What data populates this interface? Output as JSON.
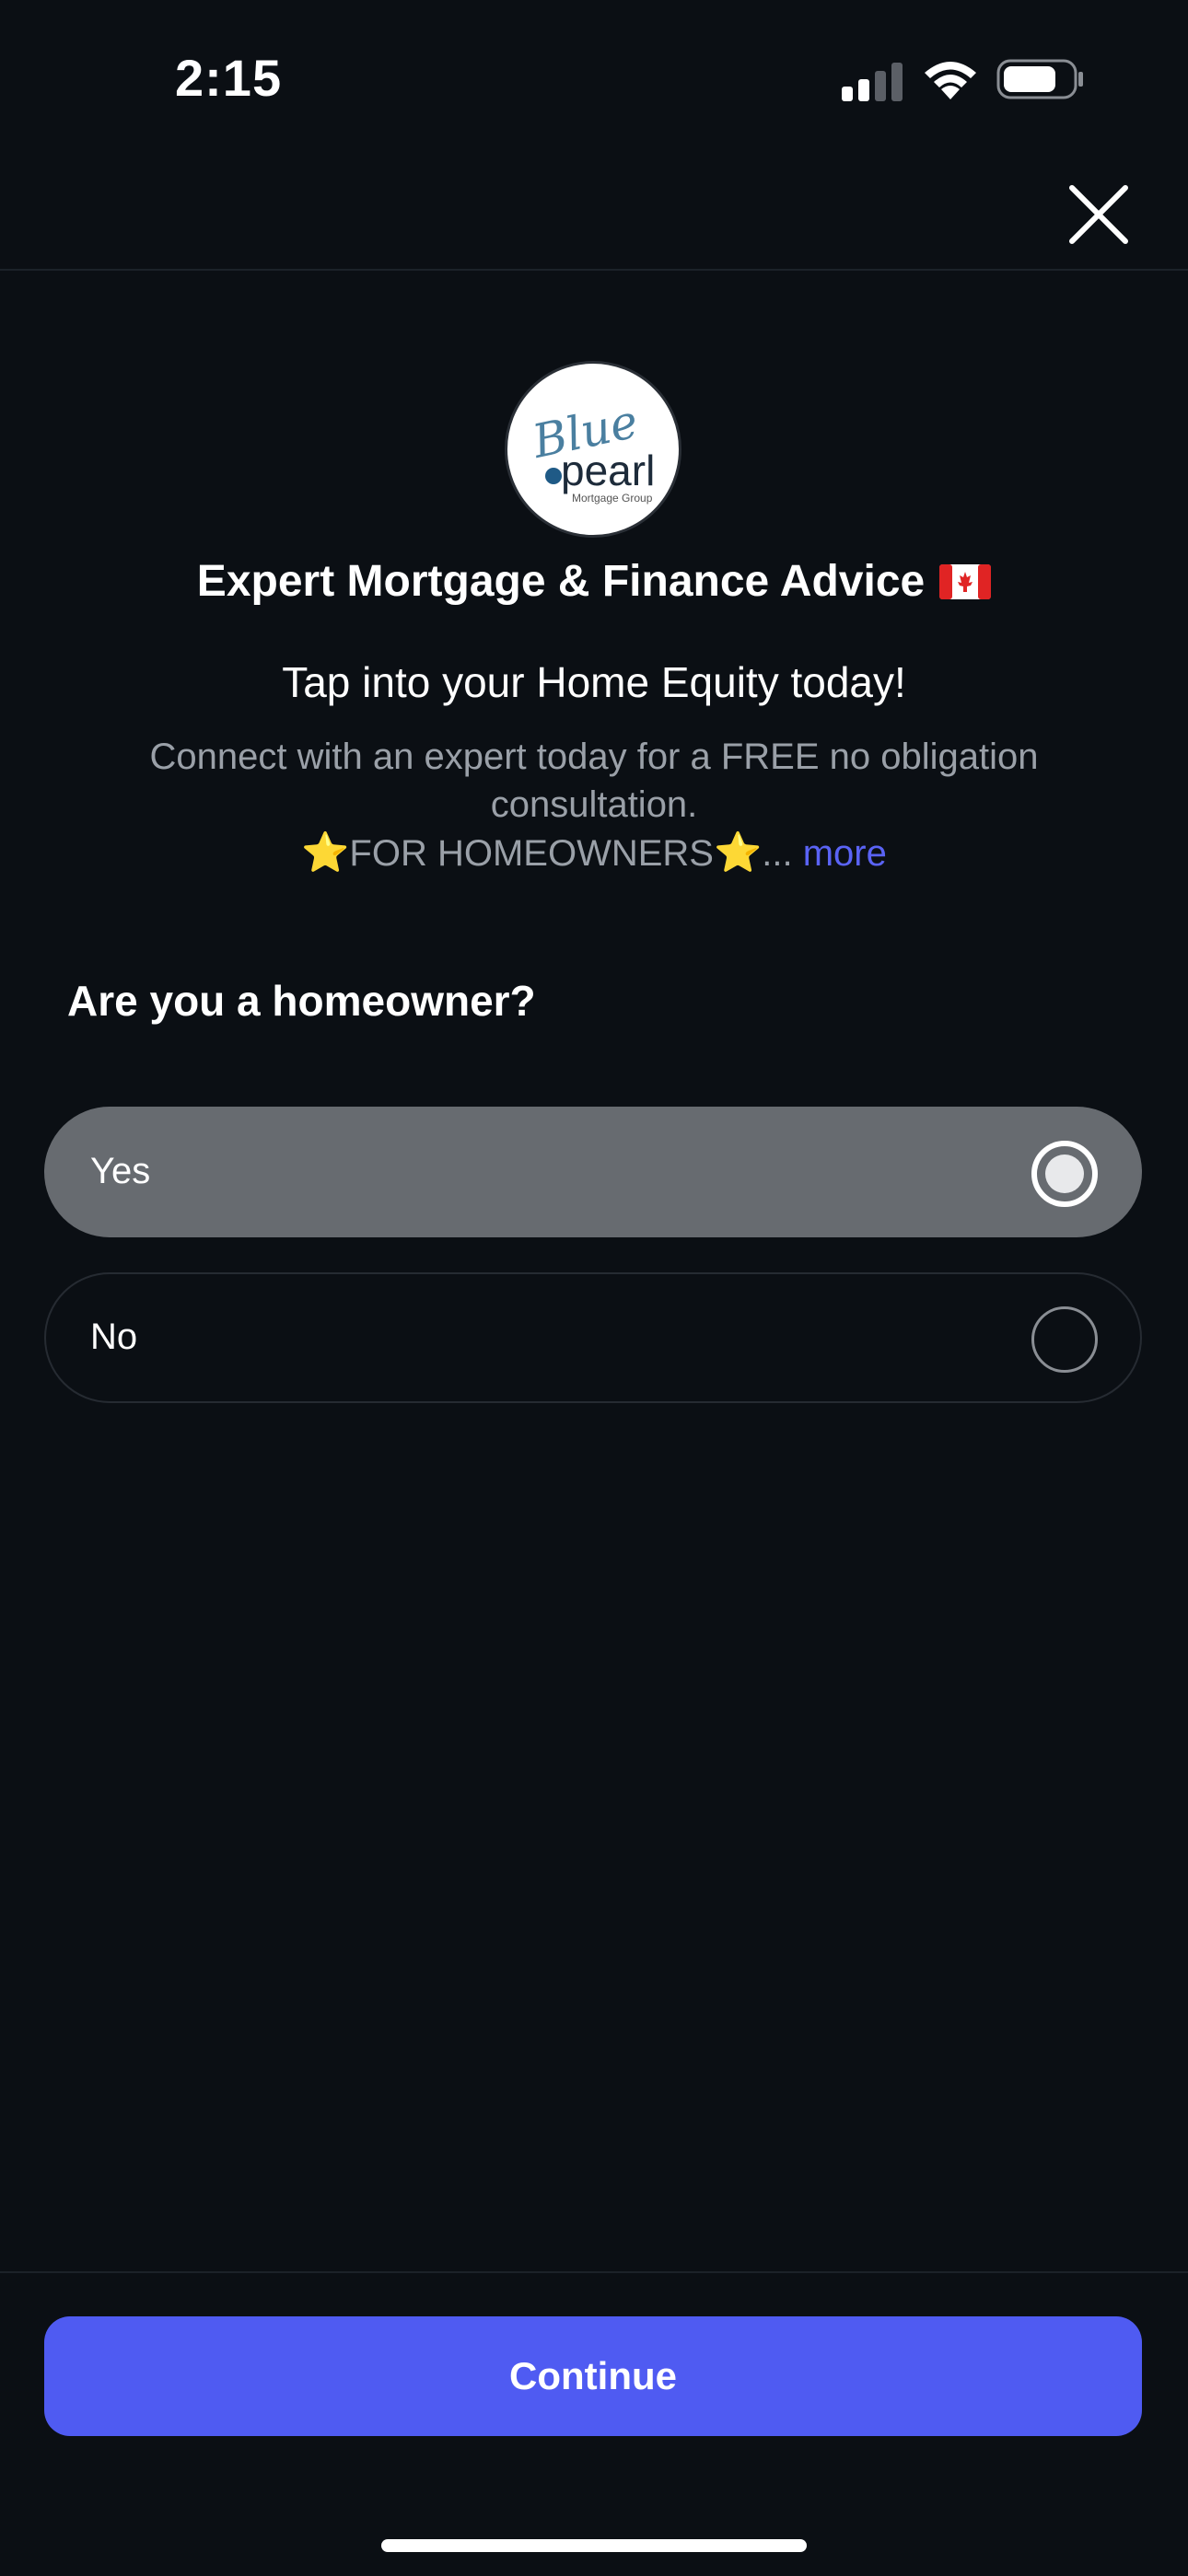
{
  "status_bar": {
    "time": "2:15",
    "signal_icon": "cellular-signal-icon",
    "wifi_icon": "wifi-icon",
    "battery_icon": "battery-icon"
  },
  "nav": {
    "close_icon": "close-icon"
  },
  "header": {
    "logo": {
      "script_text": "Blue",
      "word": "pearl",
      "tagline": "Mortgage Group"
    },
    "title": "Expert Mortgage & Finance Advice",
    "flag_icon": "canada-flag-icon",
    "subtitle": "Tap into your Home Equity today!",
    "description_line1": "Connect with an expert today for a FREE no obligation consultation.",
    "description_star": "⭐",
    "description_line2": "FOR HOMEOWNERS",
    "description_ellipsis": "...",
    "more_label": "more"
  },
  "question": {
    "label": "Are you a homeowner?",
    "options": [
      {
        "label": "Yes",
        "selected": true
      },
      {
        "label": "No",
        "selected": false
      }
    ]
  },
  "footer": {
    "continue_label": "Continue"
  },
  "colors": {
    "background": "#0b0f14",
    "accent": "#4f5bf2",
    "link": "#5a63f5",
    "selected_option": "#676b70"
  }
}
